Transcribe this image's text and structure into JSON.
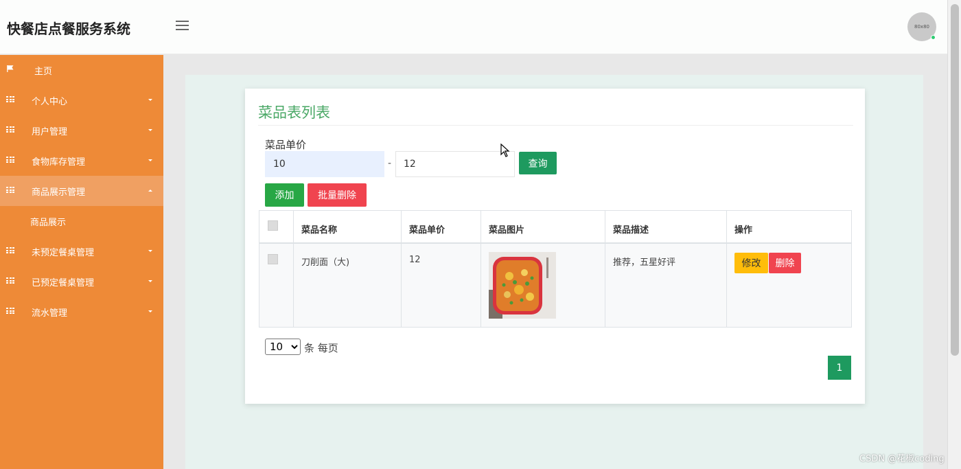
{
  "header": {
    "title": "快餐店点餐服务系统",
    "avatar_text": "80x80"
  },
  "sidebar": {
    "items": [
      {
        "label": "主页"
      },
      {
        "label": "个人中心"
      },
      {
        "label": "用户管理"
      },
      {
        "label": "食物库存管理"
      },
      {
        "label": "商品展示管理"
      },
      {
        "label": "商品展示"
      },
      {
        "label": "未预定餐桌管理"
      },
      {
        "label": "已预定餐桌管理"
      },
      {
        "label": "流水管理"
      }
    ]
  },
  "main": {
    "title": "菜品表列表",
    "filter": {
      "label": "菜品单价",
      "min_value": "10",
      "separator": "-",
      "max_value": "12",
      "query_label": "查询"
    },
    "actions": {
      "add_label": "添加",
      "batch_delete_label": "批量删除"
    },
    "table": {
      "headers": [
        "菜品名称",
        "菜品单价",
        "菜品图片",
        "菜品描述",
        "操作"
      ],
      "rows": [
        {
          "name": "刀削面（大)",
          "price": "12",
          "description": "推荐，五星好评",
          "edit_label": "修改",
          "delete_label": "删除"
        }
      ]
    },
    "pagination": {
      "page_size": "10",
      "page_size_label": "条 每页",
      "current_page": "1"
    }
  },
  "watermark": "CSDN @花椒coding",
  "colors": {
    "sidebar": "#ee8a37",
    "title": "#4aa866",
    "primary": "#1e9a5f",
    "add": "#28a745",
    "danger": "#f0444f",
    "warning": "#ffbd0a"
  }
}
